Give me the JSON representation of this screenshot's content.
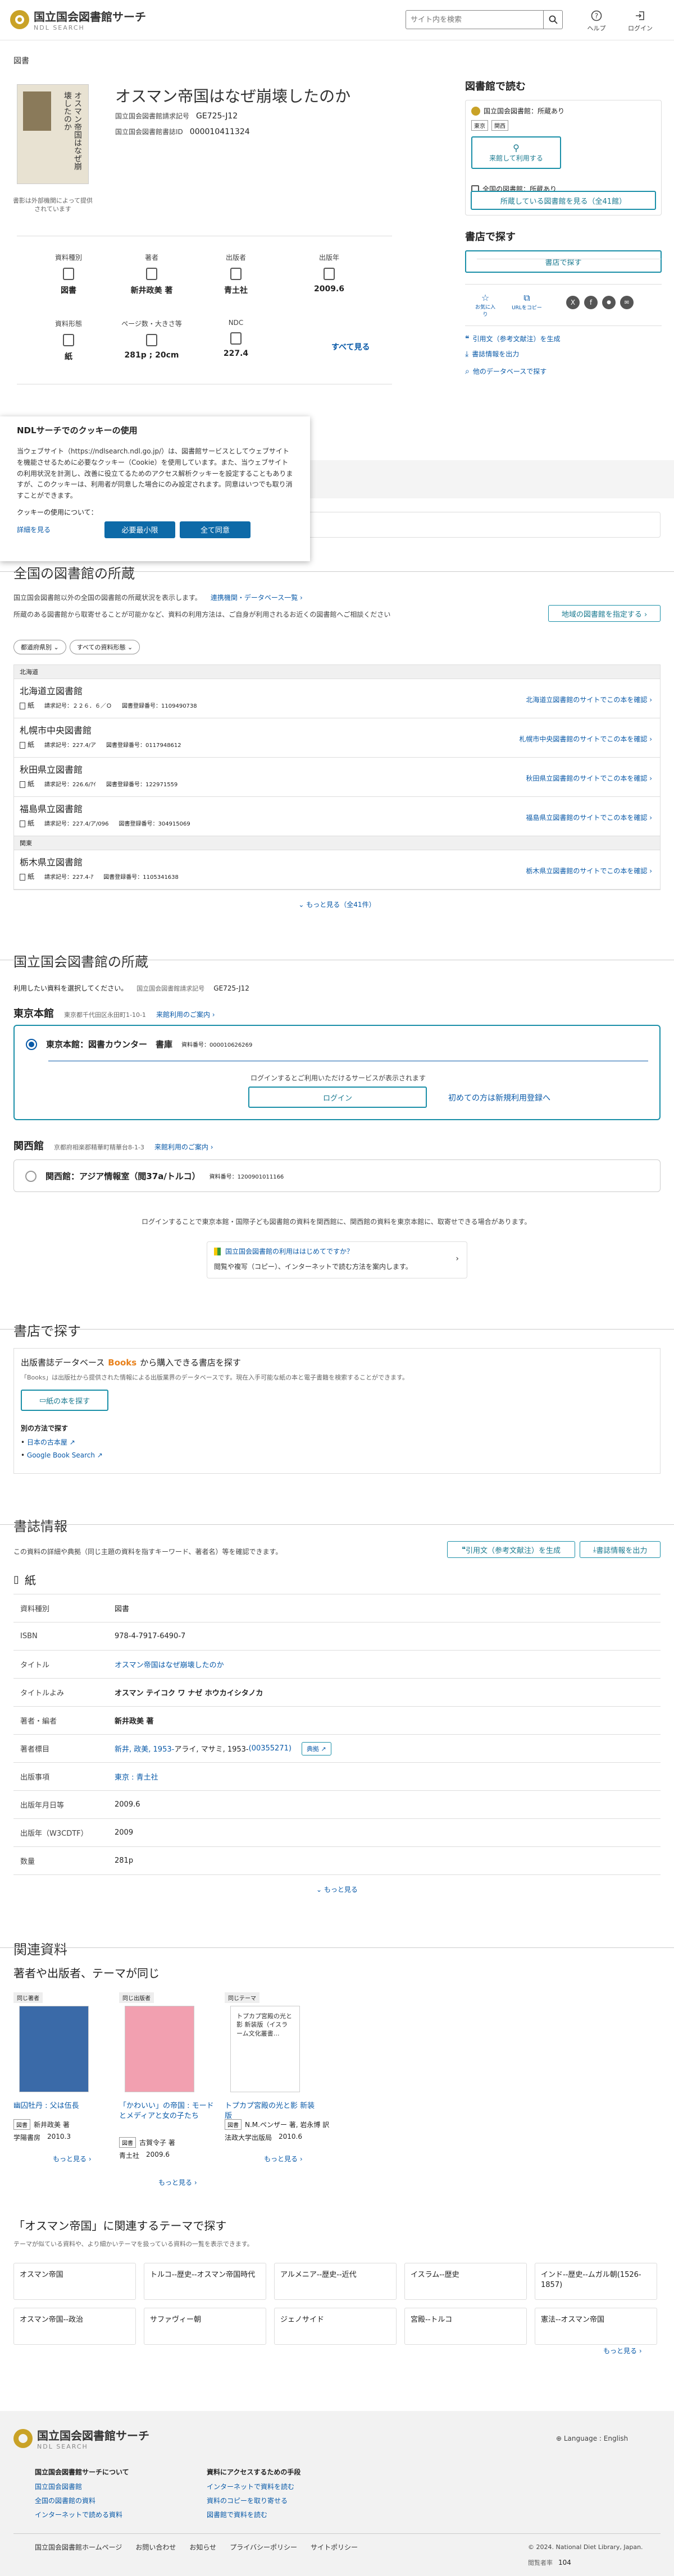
{
  "header": {
    "logo_main": "国立国会図書館サーチ",
    "logo_sub": "NDL SEARCH",
    "search_placeholder": "サイト内を検索",
    "help": "ヘルプ",
    "login": "ログイン"
  },
  "breadcrumb": "図書",
  "book": {
    "title": "オスマン帝国はなぜ崩壊したのか",
    "cover_text": "オスマン帝国はなぜ崩壊したのか",
    "cover_note": "書影は外部機関によって提供されています",
    "call_label": "国立国会図書館請求記号",
    "call_no": "GE725-J12",
    "id_label": "国立国会図書館書誌ID",
    "id_no": "000010411324"
  },
  "facets": [
    {
      "label": "資料種別",
      "value": "図書",
      "icon": "book-icon"
    },
    {
      "label": "著者",
      "value": "新井政美 著",
      "icon": "person-icon"
    },
    {
      "label": "出版者",
      "value": "青土社",
      "icon": "building-icon"
    },
    {
      "label": "出版年",
      "value": "2009.6",
      "icon": "calendar-icon"
    },
    {
      "label": "資料形態",
      "value": "紙",
      "icon": "paper-icon"
    },
    {
      "label": "ページ数・大きさ等",
      "value": "281p ; 20cm",
      "icon": "ruler-icon"
    },
    {
      "label": "NDC",
      "value": "227.4",
      "icon": "tag-icon"
    }
  ],
  "facets_more": "すべて見る",
  "side": {
    "read_title": "図書館で読む",
    "ndl_holdings": "国立国会図書館：所蔵あり",
    "loc_tokyo": "東京",
    "loc_kansai": "関西",
    "visit_btn": "来館して利用する",
    "all_holdings": "全国の図書館：所蔵あり",
    "all_btn": "所蔵している図書館を見る（全41館）",
    "buy_title": "書店で探す",
    "buy_btn": "書店で探す",
    "fav": "お気に入り",
    "copy": "URLをコピー",
    "cite": "引用文（参考文献注）を生成",
    "export": "書誌情報を出力",
    "other_db": "他のデータベースで探す"
  },
  "cookie": {
    "title": "NDLサーチでのクッキーの使用",
    "body": "当ウェブサイト（https://ndlsearch.ndl.go.jp/）は、図書館サービスとしてウェブサイトを機能させるために必要なクッキー（Cookie）を使用しています。また、当ウェブサイトの利用状況を計測し、改善に役立てるためのアクセス解析クッキーを設定することもありますが、このクッキーは、利用者が同意した場合にのみ設定されます。同意はいつでも取り消すことができます。",
    "usage": "クッキーの使用について：",
    "more": "詳細を見る",
    "essential": "必要最小限",
    "accept": "全て同意"
  },
  "national": {
    "title": "全国の図書館の所蔵",
    "desc1": "国立国会図書館以外の全国の図書館の所蔵状況を表示します。",
    "cooperating": "連携機関・データベース一覧",
    "desc2": "所蔵のある図書館から取寄せることが可能かなど、資料の利用方法は、ご自身が利用されるお近くの図書館へご相談ください",
    "region_btn": "地域の図書館を指定する",
    "filter_pref": "都道府県別",
    "filter_type": "すべての資料形態",
    "more": "もっと見る（全41件）",
    "groups": [
      {
        "region": "北海道",
        "libs": [
          {
            "name": "北海道立図書館",
            "form": "紙",
            "call": "請求記号：２２６．６／Ｏ",
            "reg": "図書登録番号：1109490738",
            "link": "北海道立図書館のサイトでこの本を確認"
          },
          {
            "name": "札幌市中央図書館",
            "form": "紙",
            "call": "請求記号：227.4/ア",
            "reg": "図書登録番号：0117948612",
            "link": "札幌市中央図書館のサイトでこの本を確認"
          },
          {
            "name": "秋田県立図書館",
            "form": "紙",
            "call": "請求記号：226.6/ｱｲ",
            "reg": "図書登録番号：122971559",
            "link": "秋田県立図書館のサイトでこの本を確認"
          },
          {
            "name": "福島県立図書館",
            "form": "紙",
            "call": "請求記号：227.4/ア/096",
            "reg": "図書登録番号：304915069",
            "link": "福島県立図書館のサイトでこの本を確認"
          }
        ]
      },
      {
        "region": "関東",
        "libs": [
          {
            "name": "栃木県立図書館",
            "form": "紙",
            "call": "請求記号：227.4-ｱ",
            "reg": "図書登録番号：1105341638",
            "link": "栃木県立図書館のサイトでこの本を確認"
          }
        ]
      }
    ]
  },
  "ndl": {
    "title": "国立国会図書館の所蔵",
    "desc": "利用したい資料を選択してください。",
    "call_label": "国立国会図書館請求記号",
    "call_no": "GE725-J12",
    "tokyo": {
      "name": "東京本館",
      "addr": "東京都千代田区永田町1-10-1",
      "guide": "来館利用のご案内",
      "item": "東京本館：図書カウンター　書庫",
      "id": "資料番号：000010626269",
      "login_note": "ログインするとご利用いただけるサービスが表示されます",
      "login_btn": "ログイン",
      "register": "初めての方は新規利用登録へ"
    },
    "kansai": {
      "name": "関西館",
      "addr": "京都府相楽郡精華町精華台8-1-3",
      "guide": "来館利用のご案内",
      "item": "関西館：アジア情報室（閲37a/トルコ）",
      "id": "資料番号：1200901011166"
    },
    "note": "ログインすることで東京本館・国際子ども図書館の資料を関西館に、関西館の資料を東京本館に、取寄せできる場合があります。",
    "first_title": "国立国会図書館の利用ははじめてですか？",
    "first_desc": "閲覧や複写（コピー）、インターネットで読む方法を案内します。"
  },
  "bookstore": {
    "title": "書店で探す",
    "lead_a": "出版書誌データベース",
    "lead_brand": "Books",
    "lead_b": "から購入できる書店を探す",
    "note": "「Books」は出版社から提供された情報による出版業界のデータベースです。現在入手可能な紙の本と電子書籍を検索することができます。",
    "btn": "紙の本を探す",
    "other": "別の方法で探す",
    "link1": "日本の古本屋",
    "link2": "Google Book Search"
  },
  "biblio": {
    "title": "書誌情報",
    "desc": "この資料の詳細や典拠（同じ主題の資料を指すキーワード、著者名）等を確認できます。",
    "cite_btn": "引用文（参考文献注）を生成",
    "export_btn": "書誌情報を出力",
    "form": "紙",
    "rows": [
      {
        "k": "資料種別",
        "v": "図書"
      },
      {
        "k": "ISBN",
        "v": "978-4-7917-6490-7"
      },
      {
        "k": "タイトル",
        "v": "オスマン帝国はなぜ崩壊したのか",
        "link": true
      },
      {
        "k": "タイトルよみ",
        "v": "オスマン テイコク ワ ナゼ ホウカイシタノカ",
        "bold": true
      },
      {
        "k": "著者・編者",
        "v": "新井政美 著",
        "bold": true
      },
      {
        "k": "著者標目",
        "v": "新井, 政美, 1953-",
        "v2": " アライ, マサミ, 1953- ",
        "v3": "(00355271)",
        "badge": "典拠"
      },
      {
        "k": "出版事項",
        "v": "東京 : 青土社",
        "link": true
      },
      {
        "k": "出版年月日等",
        "v": "2009.6"
      },
      {
        "k": "出版年（W3CDTF）",
        "v": "2009"
      },
      {
        "k": "数量",
        "v": "281p"
      }
    ],
    "more": "もっと見る"
  },
  "related": {
    "title": "関連資料",
    "sub": "著者や出版者、テーマが同じ",
    "cols": [
      {
        "head": "同じ著者",
        "title": "幽囚牡丹 : 父は伍長",
        "tag": "図書",
        "author": "新井政美 著",
        "pub": "学陽書房",
        "year": "2010.3",
        "more": "もっと見る"
      },
      {
        "head": "同じ出版者",
        "title": "「かわいい」の帝国 : モードとメディアと女の子たち",
        "tag": "図書",
        "author": "古賀令子 著",
        "pub": "青土社",
        "year": "2009.6",
        "more": "もっと見る"
      },
      {
        "head": "同じテーマ",
        "title": "トプカプ宮殿の光と影 新装版",
        "cover_text": "トプカプ宮殿の光と影 新装版（イスラーム文化叢書…",
        "tag": "図書",
        "author": "N.M.ペンザー 著, 岩永博 訳",
        "pub": "法政大学出版局",
        "year": "2010.6",
        "more": "もっと見る"
      }
    ]
  },
  "themes": {
    "title": "「オスマン帝国」に関連するテーマで探す",
    "desc": "テーマが似ている資料や、より細かいテーマを扱っている資料の一覧を表示できます。",
    "items": [
      "オスマン帝国",
      "トルコ--歴史--オスマン帝国時代",
      "アルメニア--歴史--近代",
      "イスラム--歴史",
      "インド--歴史--ムガル朝(1526-1857)",
      "オスマン帝国--政治",
      "サファヴィー朝",
      "ジェノサイド",
      "宮殿--トルコ",
      "憲法--オスマン帝国"
    ],
    "more": "もっと見る"
  },
  "footer": {
    "logo_main": "国立国会図書館サーチ",
    "logo_sub": "NDL SEARCH",
    "language": "Language : English",
    "about_title": "国立国会図書館サーチについて",
    "about_links": [
      "国立国会図書館",
      "全国の図書館の資料",
      "インターネットで読める資料"
    ],
    "access_title": "資料にアクセスするための手段",
    "access_links": [
      "インターネットで資料を読む",
      "資料のコピーを取り寄せる",
      "図書館で資料を読む"
    ],
    "bottom_links": [
      "国立国会図書館ホームページ",
      "お問い合わせ",
      "お知らせ",
      "プライバシーポリシー",
      "サイトポリシー"
    ],
    "copyright": "© 2024. National Diet Library, Japan.",
    "visitors_label": "閲覧者率",
    "visitors": "104"
  }
}
